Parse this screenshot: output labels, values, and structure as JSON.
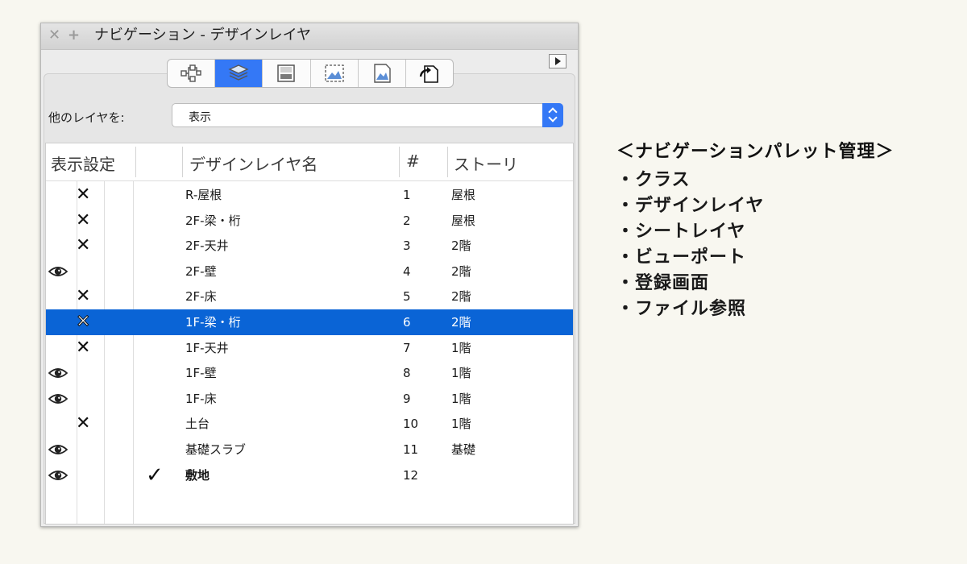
{
  "window": {
    "title": "ナビゲーション - デザインレイヤ",
    "close": "✕",
    "add": "+"
  },
  "tabs": [
    {
      "name": "classes",
      "icon": "class-tree-icon",
      "active": false
    },
    {
      "name": "design-layers",
      "icon": "layers-icon",
      "active": true
    },
    {
      "name": "sheet-layers",
      "icon": "sheet-icon",
      "active": false
    },
    {
      "name": "viewports",
      "icon": "viewport-icon",
      "active": false
    },
    {
      "name": "saved-views",
      "icon": "saved-view-icon",
      "active": false
    },
    {
      "name": "references",
      "icon": "reference-file-icon",
      "active": false
    }
  ],
  "other_layers": {
    "label": "他のレイヤを:",
    "value": "表示"
  },
  "columns": {
    "visibility": "表示設定",
    "name": "デザインレイヤ名",
    "number": "#",
    "story": "ストーリ"
  },
  "rows": [
    {
      "vis": "hidden",
      "active": false,
      "name": "R-屋根",
      "num": "1",
      "story": "屋根",
      "selected": false
    },
    {
      "vis": "hidden",
      "active": false,
      "name": "2F-梁・桁",
      "num": "2",
      "story": "屋根",
      "selected": false
    },
    {
      "vis": "hidden",
      "active": false,
      "name": "2F-天井",
      "num": "3",
      "story": "2階",
      "selected": false
    },
    {
      "vis": "visible",
      "active": false,
      "name": "2F-壁",
      "num": "4",
      "story": "2階",
      "selected": false
    },
    {
      "vis": "hidden",
      "active": false,
      "name": "2F-床",
      "num": "5",
      "story": "2階",
      "selected": false
    },
    {
      "vis": "hidden",
      "active": false,
      "name": "1F-梁・桁",
      "num": "6",
      "story": "2階",
      "selected": true
    },
    {
      "vis": "hidden",
      "active": false,
      "name": "1F-天井",
      "num": "7",
      "story": "1階",
      "selected": false
    },
    {
      "vis": "visible",
      "active": false,
      "name": "1F-壁",
      "num": "8",
      "story": "1階",
      "selected": false
    },
    {
      "vis": "visible",
      "active": false,
      "name": "1F-床",
      "num": "9",
      "story": "1階",
      "selected": false
    },
    {
      "vis": "hidden",
      "active": false,
      "name": "土台",
      "num": "10",
      "story": "1階",
      "selected": false
    },
    {
      "vis": "visible",
      "active": false,
      "name": "基礎スラブ",
      "num": "11",
      "story": "基礎",
      "selected": false
    },
    {
      "vis": "visible",
      "active": true,
      "name": "敷地",
      "num": "12",
      "story": "",
      "selected": false
    }
  ],
  "glyphs": {
    "hidden": "✕",
    "check": "✓"
  },
  "side_note": {
    "title": "＜ナビゲーションパレット管理＞",
    "items": [
      "・クラス",
      "・デザインレイヤ",
      "・シートレイヤ",
      "・ビューポート",
      "・登録画面",
      "・ファイル参照"
    ]
  },
  "colors": {
    "accent": "#3478f6",
    "selection": "#0a64d6",
    "background": "#f8f7f0"
  }
}
